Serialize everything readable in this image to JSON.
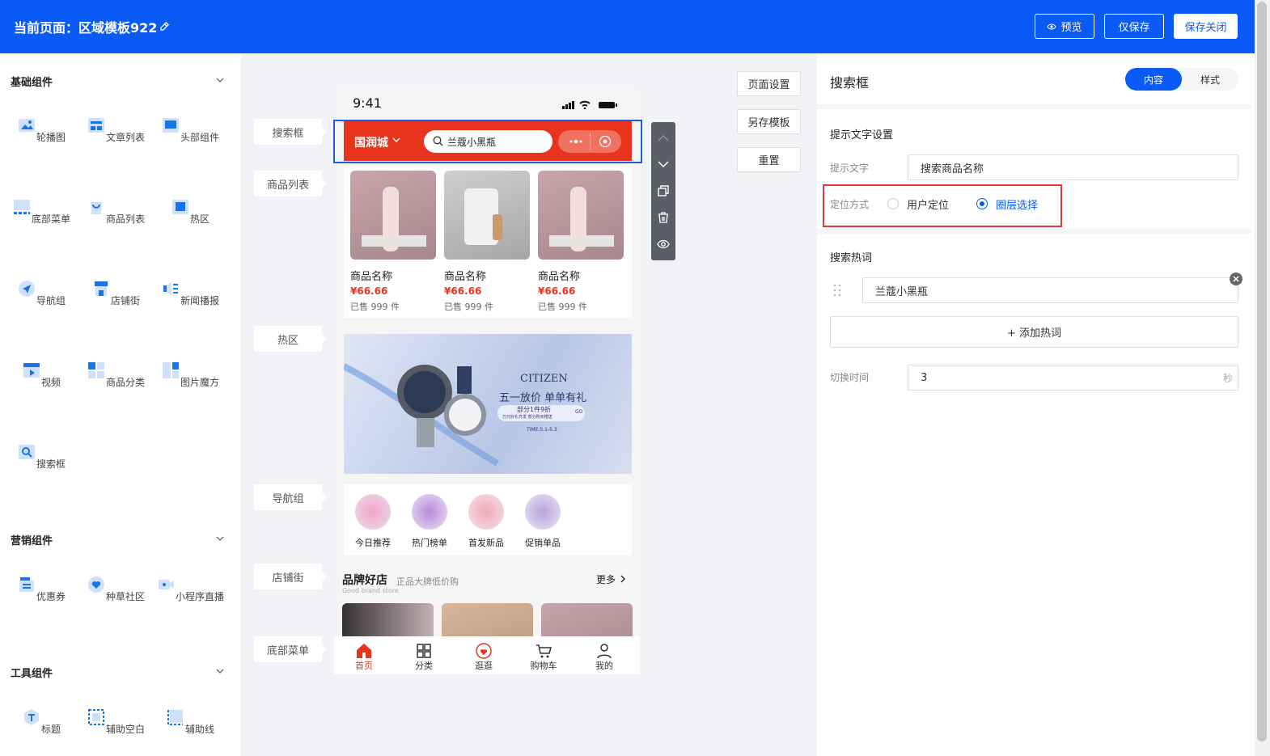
{
  "header": {
    "title": "当前页面：区域模板922",
    "preview": "预览",
    "save": "仅保存",
    "save_close": "保存关闭"
  },
  "left": {
    "sections": [
      {
        "title": "基础组件",
        "items": [
          "轮播图",
          "文章列表",
          "头部组件",
          "底部菜单",
          "商品列表",
          "热区",
          "导航组",
          "店铺街",
          "新闻播报",
          "视频",
          "商品分类",
          "图片魔方",
          "搜索框"
        ]
      },
      {
        "title": "营销组件",
        "items": [
          "优惠券",
          "种草社区",
          "小程序直播"
        ]
      },
      {
        "title": "工具组件",
        "items": [
          "标题",
          "辅助空白",
          "辅助线"
        ]
      }
    ]
  },
  "canvas": {
    "tags": [
      "搜索框",
      "商品列表",
      "热区",
      "导航组",
      "店铺街",
      "底部菜单"
    ],
    "page_buttons": [
      "页面设置",
      "另存模板",
      "重置"
    ]
  },
  "phone": {
    "time": "9:41",
    "city": "国润城",
    "search": "兰蔻小黑瓶",
    "products": [
      {
        "name": "商品名称",
        "price": "¥66.66",
        "sold": "已售 999 件"
      },
      {
        "name": "商品名称",
        "price": "¥66.66",
        "sold": "已售 999 件"
      },
      {
        "name": "商品名称",
        "price": "¥66.66",
        "sold": "已售 999 件"
      }
    ],
    "banner": {
      "brand": "CITIZEN",
      "slogan": "五一放价 单单有礼",
      "sub": "部分1件9折",
      "sub2": "万元好礼齐发 部分购买赠送",
      "go": "GO",
      "date": "TIME:5.1-5.3"
    },
    "nav": [
      "今日推荐",
      "热门榜单",
      "首发新品",
      "促销单品"
    ],
    "shop": {
      "title": "品牌好店",
      "subtitle": "正品大牌低价购",
      "en": "Good brand store",
      "more": "更多"
    },
    "tabbar": [
      "首页",
      "分类",
      "逛逛",
      "购物车",
      "我的"
    ]
  },
  "right": {
    "title": "搜索框",
    "tab_content": "内容",
    "tab_style": "样式",
    "hint_section": "提示文字设置",
    "hint_label": "提示文字",
    "hint_value": "搜索商品名称",
    "locate_label": "定位方式",
    "opt_user": "用户定位",
    "opt_layer": "圈层选择",
    "hot_section": "搜索热词",
    "hot_word": "兰蔻小黑瓶",
    "add_hot": "+ 添加热词",
    "switch_label": "切换时间",
    "switch_value": "3",
    "unit": "秒"
  },
  "colors": {
    "primary": "#0a5af5",
    "search_bar": "#e8341c",
    "price": "#e8341c",
    "highlight": "#e53935"
  }
}
